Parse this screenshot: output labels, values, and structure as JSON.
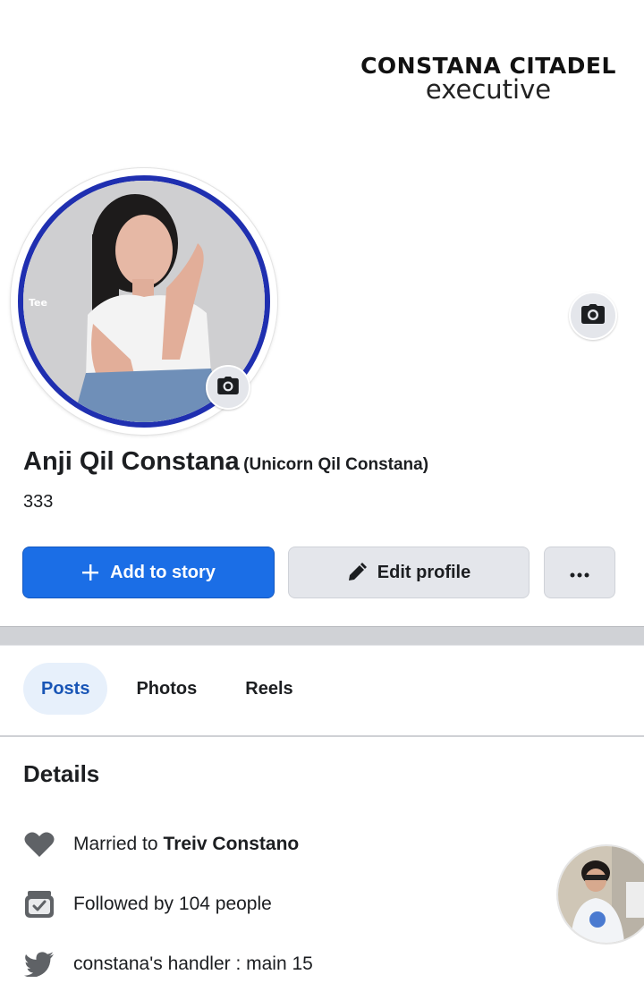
{
  "brand": {
    "title": "CONSTANA CITADEL",
    "subtitle": "executive"
  },
  "profile": {
    "name": "Anji Qil Constana",
    "alternate_name": "(Unicorn Qil Constana)",
    "friends_count": "333",
    "avatar_icon": "profile-photo",
    "avatar_ring_color": "#1f2fb0"
  },
  "actions": {
    "add_story_label": "Add to story",
    "edit_profile_label": "Edit profile",
    "more_label": "···",
    "primary_color": "#1b6ee6"
  },
  "tabs": [
    {
      "label": "Posts",
      "active": true
    },
    {
      "label": "Photos",
      "active": false
    },
    {
      "label": "Reels",
      "active": false
    }
  ],
  "details": {
    "title": "Details",
    "married_prefix": "Married to",
    "married_name": "Treiv Constano",
    "followed_by": "Followed by 104 people",
    "handle": "constana's handler : main 15",
    "icons": [
      "heart-icon",
      "followers-icon",
      "twitter-bird-icon"
    ]
  }
}
